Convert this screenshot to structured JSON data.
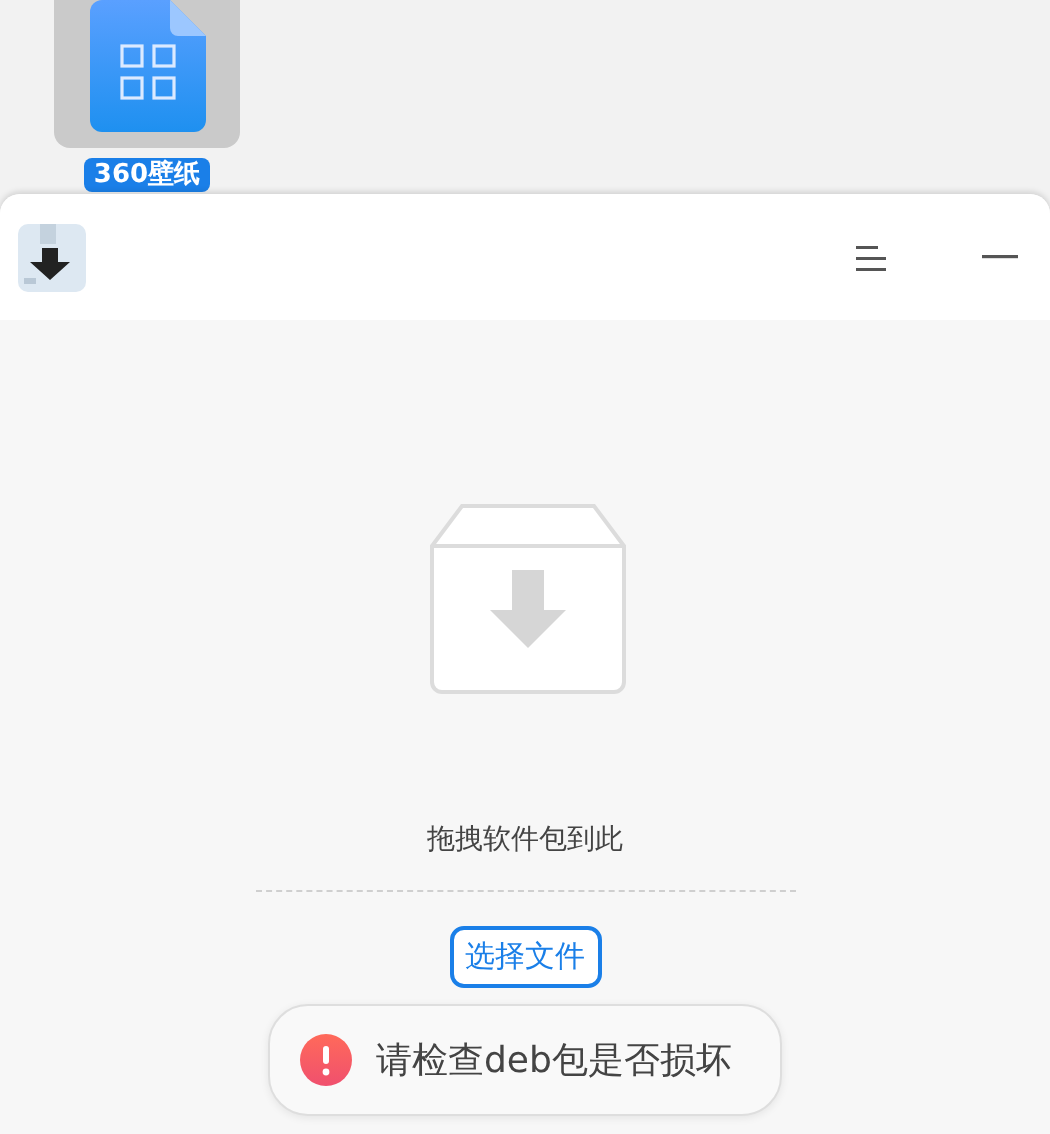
{
  "desktop": {
    "icons": [
      {
        "label": "360壁纸",
        "selected": true
      }
    ]
  },
  "window": {
    "drop_hint": "拖拽软件包到此",
    "select_button": "选择文件"
  },
  "toast": {
    "kind": "error",
    "message": "请检查deb包是否损坏"
  }
}
